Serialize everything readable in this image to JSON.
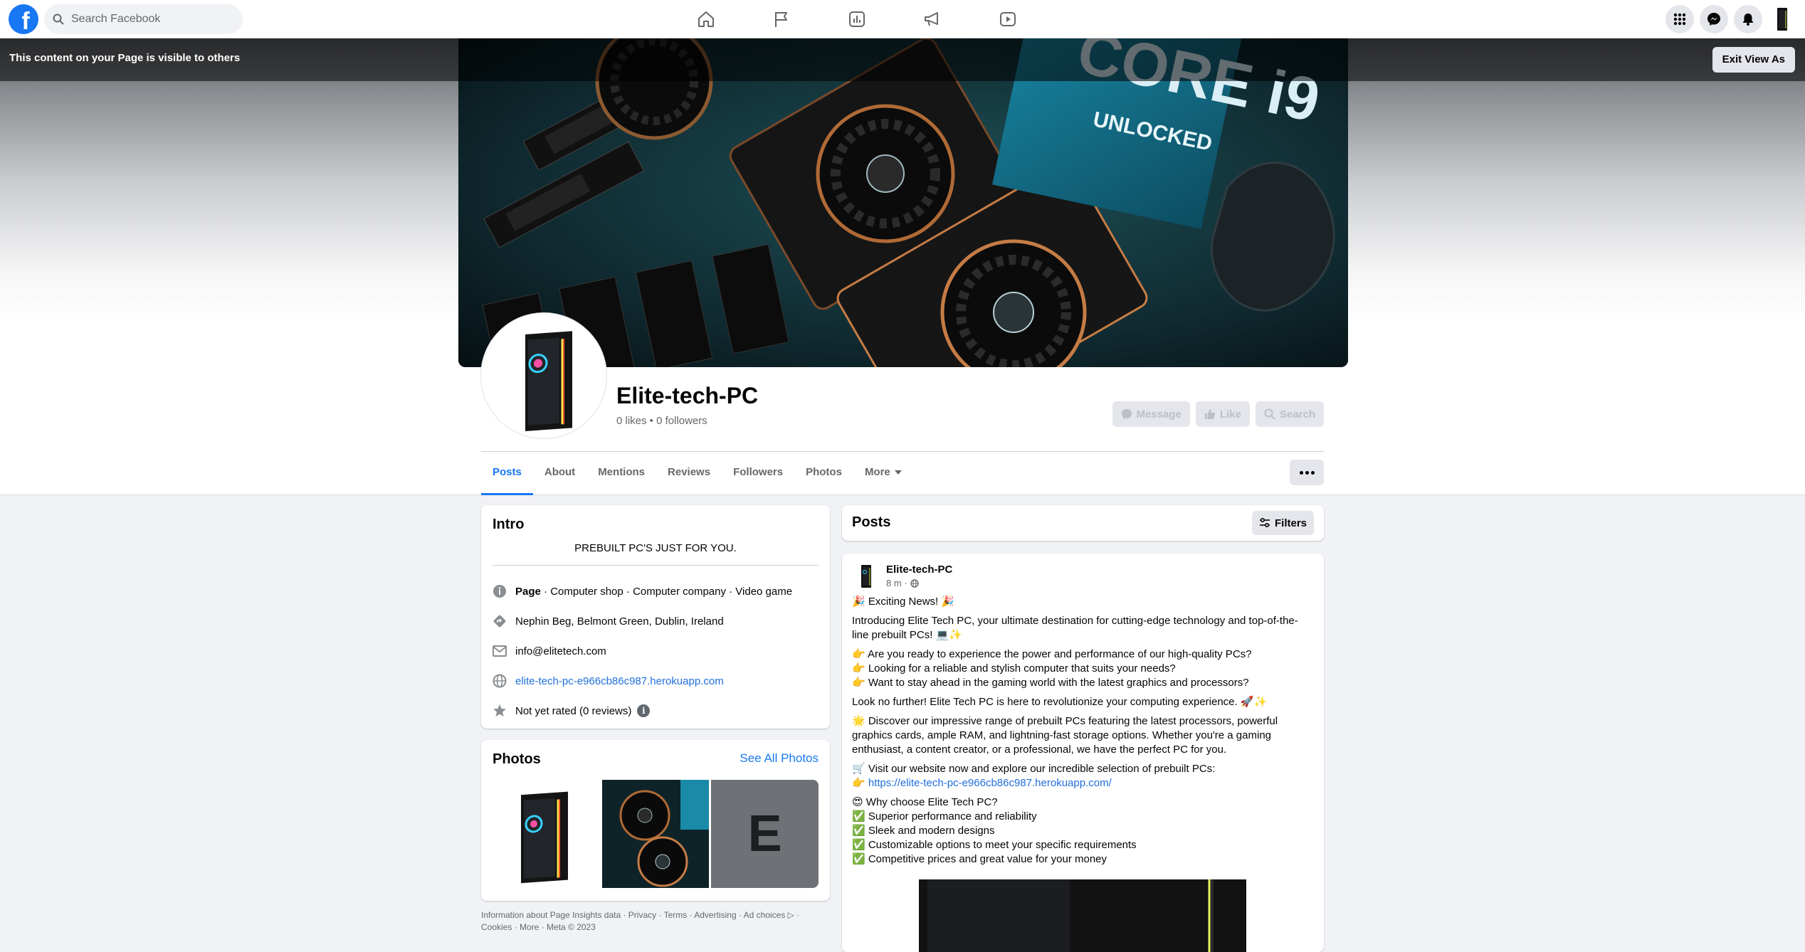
{
  "topnav": {
    "logo_letter": "f",
    "search_placeholder": "Search Facebook",
    "nav_icons": [
      "home-icon",
      "pages-flag-icon",
      "insights-icon",
      "ads-megaphone-icon",
      "video-icon"
    ],
    "right_icons": [
      "menu-grid-icon",
      "messenger-icon",
      "notifications-bell-icon",
      "page-avatar"
    ]
  },
  "view_banner": {
    "text": "This content on your Page is visible to others",
    "exit_label": "Exit View As"
  },
  "page": {
    "name": "Elite-tech-PC",
    "stats": "0 likes • 0 followers",
    "actions": [
      "Message",
      "Like",
      "Search"
    ]
  },
  "tabs": {
    "items": [
      "Posts",
      "About",
      "Mentions",
      "Reviews",
      "Followers",
      "Photos",
      "More"
    ],
    "active": "Posts"
  },
  "intro": {
    "title": "Intro",
    "bio": "PREBUILT PC'S JUST FOR YOU.",
    "category_bold": "Page",
    "category_rest": " · Computer shop · Computer company · Video game",
    "address": "Nephin Beg, Belmont Green, Dublin, Ireland",
    "email": "info@elitetech.com",
    "website": "elite-tech-pc-e966cb86c987.herokuapp.com",
    "rating": "Not yet rated (0 reviews)",
    "rating_info": "i"
  },
  "photos": {
    "title": "Photos",
    "see_all": "See All Photos",
    "placeholder_letter": "E"
  },
  "footer": {
    "text": "Information about Page Insights data · Privacy · Terms · Advertising · Ad choices ▷ · Cookies · More · Meta © 2023"
  },
  "posts_header": {
    "title": "Posts",
    "filters_label": "Filters"
  },
  "post": {
    "author": "Elite-tech-PC",
    "time": "8 m ·",
    "lines": {
      "l1": "🎉 Exciting News! 🎉",
      "l2": "Introducing Elite Tech PC, your ultimate destination for cutting-edge technology and top-of-the-line prebuilt PCs! 💻✨",
      "l3a": "👉 Are you ready to experience the power and performance of our high-quality PCs?",
      "l3b": "👉 Looking for a reliable and stylish computer that suits your needs?",
      "l3c": "👉 Want to stay ahead in the gaming world with the latest graphics and processors?",
      "l4": "Look no further! Elite Tech PC is here to revolutionize your computing experience. 🚀✨",
      "l5": "🌟 Discover our impressive range of prebuilt PCs featuring the latest processors, powerful graphics cards, ample RAM, and lightning-fast storage options. Whether you're a gaming enthusiast, a content creator, or a professional, we have the perfect PC for you.",
      "l6a": "🛒 Visit our website now and explore our incredible selection of prebuilt PCs:",
      "l6b_prefix": "👉 ",
      "l6b_link": "https://elite-tech-pc-e966cb86c987.herokuapp.com/",
      "l7a": "😍 Why choose Elite Tech PC?",
      "l7b": "✅ Superior performance and reliability",
      "l7c": "✅ Sleek and modern designs",
      "l7d": "✅ Customizable options to meet your specific requirements",
      "l7e": "✅ Competitive prices and great value for your money"
    }
  },
  "colors": {
    "accent": "#1877f2",
    "link": "#216fdb",
    "background": "#f0f2f5",
    "muted_text": "#65676b"
  }
}
